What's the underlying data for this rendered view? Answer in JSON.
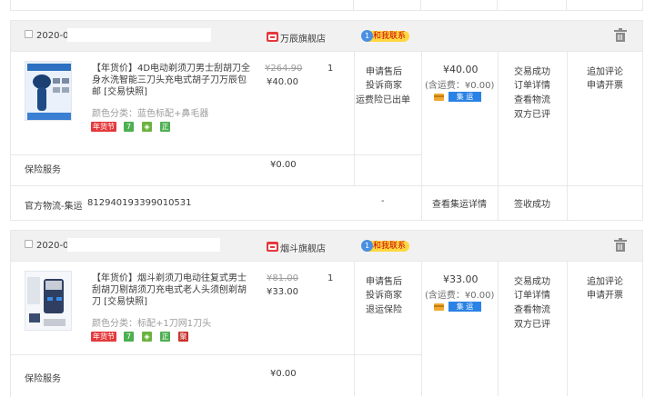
{
  "orders": [
    {
      "date": "2020-0",
      "shop": "万辰旗舰店",
      "contact": "和我联系",
      "contact_badge": "1",
      "product": {
        "title": "【年货价】4D电动剃须刀男士刮胡刀全身水洗智能三刀头充电式胡子刀万辰包邮 [交易快照]",
        "spec": "颜色分类：蓝色标配+鼻毛器",
        "badges": [
          "年货节",
          "7",
          "",
          "正"
        ],
        "original_price": "¥264.90",
        "price": "¥40.00",
        "qty": "1",
        "actions": [
          "申请售后",
          "投诉商家",
          "运费险已出单"
        ]
      },
      "total": "¥40.00",
      "shipping": "(含运费：¥0.00)",
      "shipping_tag": "集 运",
      "status": [
        "交易成功",
        "订单详情",
        "查看物流",
        "双方已评"
      ],
      "ops": [
        "追加评论",
        "申请开票"
      ],
      "insurance": {
        "label": "保险服务",
        "price": "¥0.00"
      },
      "logistics": {
        "label": "官方物流-集运",
        "tracking": "812940193399010531",
        "dash": "-",
        "detail": "查看集运详情",
        "status": "签收成功"
      }
    },
    {
      "date": "2020-0",
      "shop": "烟斗旗舰店",
      "contact": "和我联系",
      "contact_badge": "1",
      "product": {
        "title": "【年货价】烟斗剃须刀电动往复式男士刮胡刀剔胡须刀充电式老人头须刨剃胡刀 [交易快照]",
        "spec": "颜色分类：标配+1刀网1刀头",
        "badges": [
          "年货节",
          "7",
          "",
          "正",
          "聚"
        ],
        "original_price": "¥81.00",
        "price": "¥33.00",
        "qty": "1",
        "actions": [
          "申请售后",
          "投诉商家",
          "退运保险"
        ]
      },
      "total": "¥33.00",
      "shipping": "(含运费：¥0.00)",
      "shipping_tag": "集 运",
      "status": [
        "交易成功",
        "订单详情",
        "查看物流",
        "双方已评"
      ],
      "ops": [
        "追加评论",
        "申请开票"
      ],
      "insurance": {
        "label": "保险服务",
        "price": "¥0.00"
      }
    }
  ]
}
